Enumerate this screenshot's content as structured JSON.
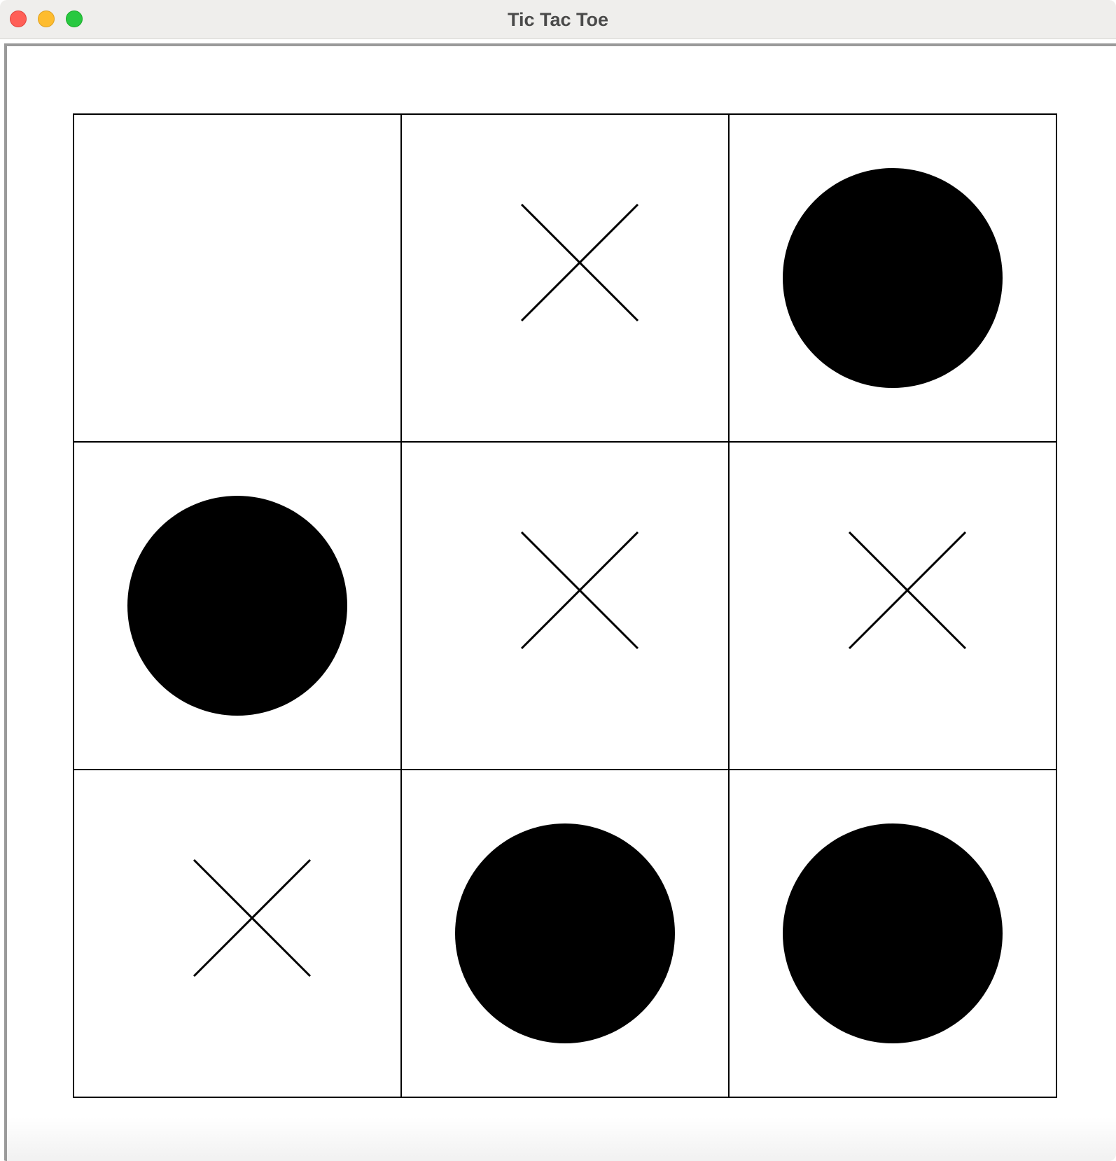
{
  "window": {
    "title": "Tic Tac Toe"
  },
  "board": {
    "rows": 3,
    "cols": 3,
    "cells": [
      [
        "",
        "X",
        "O"
      ],
      [
        "O",
        "X",
        "X"
      ],
      [
        "X",
        "O",
        "O"
      ]
    ],
    "x_mark": "x-icon",
    "o_mark": "filled-circle-icon",
    "line_color": "#000000",
    "background_color": "#ffffff"
  }
}
